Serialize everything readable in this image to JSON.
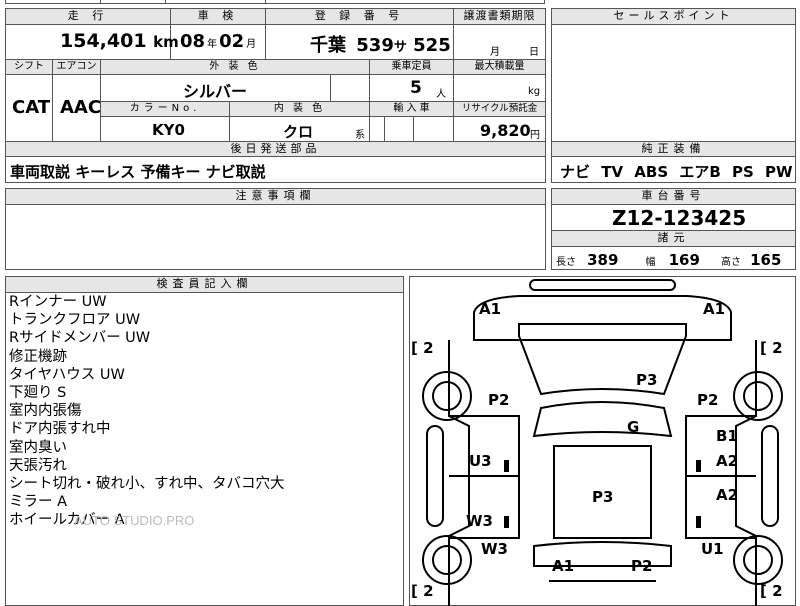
{
  "top_partial": {
    "text": "国標 車"
  },
  "header": {
    "mileage_label": "走 行",
    "shaken_label": "車 検",
    "plate_label": "登 録 番 号",
    "transfer_label": "譲渡書類期限",
    "sales_point_label": "セールスポイント"
  },
  "values": {
    "mileage": "154,401",
    "mileage_unit": "km",
    "shaken_year": "08",
    "shaken_year_unit": "年",
    "shaken_month": "02",
    "shaken_month_unit": "月",
    "plate_region": "千葉",
    "plate_number": "539",
    "plate_kana": "サ",
    "plate_serial": "525",
    "transfer_month_unit": "月",
    "transfer_day_unit": "日"
  },
  "row2": {
    "shift_label": "シフト",
    "aircon_label": "エアコン",
    "exterior_label": "外 装 色",
    "capacity_label": "乗車定員",
    "maxload_label": "最大積載量",
    "shift": "CAT",
    "aircon": "AAC",
    "exterior_color": "シルバー",
    "capacity": "5",
    "capacity_unit": "人",
    "maxload_unit": "kg",
    "color_no_label": "カラーNo.",
    "interior_label": "内 装 色",
    "import_label": "輸 入 車",
    "recycle_label": "リサイクル預託金",
    "color_no": "KY0",
    "interior_color": "クロ",
    "interior_unit": "系",
    "recycle_fee": "9,820",
    "recycle_unit": "円"
  },
  "later_parts": {
    "label": "後日発送部品",
    "value": "車両取説 キーレス 予備キー ナビ取説"
  },
  "equipment": {
    "label": "純正装備",
    "value": "ナビ TV ABS エアB PS PW"
  },
  "caution": {
    "label": "注意事項欄"
  },
  "chassis": {
    "label": "車台番号",
    "value": "Z12-123425",
    "spec_label": "諸元",
    "length_label": "長さ",
    "length": "389",
    "width_label": "幅",
    "width": "169",
    "height_label": "高さ",
    "height": "165"
  },
  "inspector": {
    "label": "検査員記入欄",
    "notes": [
      "Rインナー UW",
      "トランクフロア UW",
      "Rサイドメンバー UW",
      "修正機跡",
      "タイヤハウス UW",
      "下廻り S",
      "室内内張傷",
      "ドア内張すれ中",
      "室内臭い",
      "天張汚れ",
      "シート切れ・破れ小、すれ中、タバコ穴大",
      "ミラー A",
      "ホイールカバー A"
    ],
    "watermark": "AUTO STUDIO.PRO"
  },
  "diagram": {
    "marks": {
      "front_left": "A1",
      "front_right": "A1",
      "tire_fl": "2",
      "tire_fr": "2",
      "tire_rl": "2",
      "tire_rr": "2",
      "hood": "P3",
      "left_fender": "P2",
      "right_fender": "P2",
      "windshield": "G",
      "left_front_door": "U3",
      "right_front_door_top": "B1",
      "right_front_door": "A2",
      "roof": "P3",
      "left_rear_door": "W3",
      "right_rear_door": "A2",
      "left_quarter": "W3",
      "right_quarter": "U1",
      "rear_left": "A1",
      "rear_right": "P2"
    }
  }
}
